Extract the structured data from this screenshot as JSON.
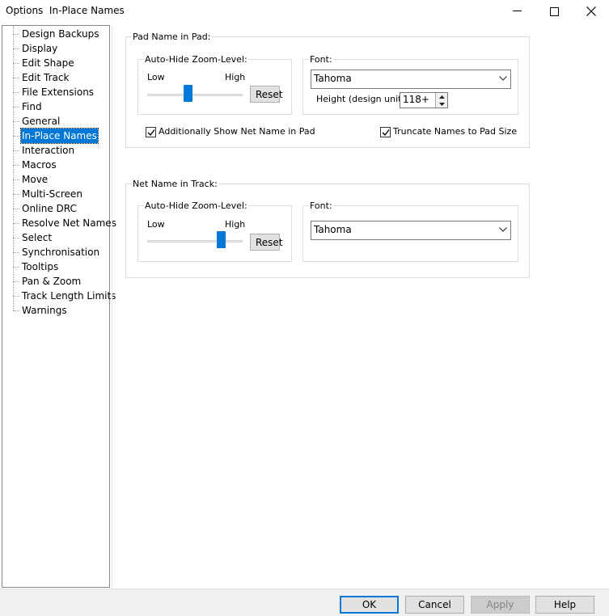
{
  "window": {
    "title": "Options  In-Place Names"
  },
  "tree": {
    "items": [
      {
        "label": "Design Backups"
      },
      {
        "label": "Display"
      },
      {
        "label": "Edit Shape"
      },
      {
        "label": "Edit Track"
      },
      {
        "label": "File Extensions"
      },
      {
        "label": "Find"
      },
      {
        "label": "General"
      },
      {
        "label": "In-Place Names",
        "selected": true
      },
      {
        "label": "Interaction"
      },
      {
        "label": "Macros"
      },
      {
        "label": "Move"
      },
      {
        "label": "Multi-Screen"
      },
      {
        "label": "Online DRC"
      },
      {
        "label": "Resolve Net Names"
      },
      {
        "label": "Select"
      },
      {
        "label": "Synchronisation"
      },
      {
        "label": "Tooltips"
      },
      {
        "label": "Pan & Zoom"
      },
      {
        "label": "Track Length Limits"
      },
      {
        "label": "Warnings"
      }
    ]
  },
  "pad_group": {
    "legend": "Pad Name in Pad:",
    "zoom": {
      "legend": "Auto-Hide Zoom-Level:",
      "low_label": "Low",
      "high_label": "High",
      "slider_value": 0.42,
      "reset_label": "Reset"
    },
    "font": {
      "legend": "Font:",
      "value": "Tahoma",
      "height_label": "Height (design units):",
      "height_value": "118+"
    },
    "show_net_name": {
      "label": "Additionally Show Net Name in Pad",
      "checked": true
    },
    "truncate": {
      "label": "Truncate Names to Pad Size",
      "checked": true
    }
  },
  "track_group": {
    "legend": "Net Name in Track:",
    "zoom": {
      "legend": "Auto-Hide Zoom-Level:",
      "low_label": "Low",
      "high_label": "High",
      "slider_value": 0.8,
      "reset_label": "Reset"
    },
    "font": {
      "legend": "Font:",
      "value": "Tahoma"
    }
  },
  "footer": {
    "ok_label": "OK",
    "cancel_label": "Cancel",
    "apply_label": "Apply",
    "help_label": "Help"
  },
  "colors": {
    "accent": "#0078d7",
    "window_bg": "#ffffff",
    "footer_bg": "#f0f0f0"
  }
}
